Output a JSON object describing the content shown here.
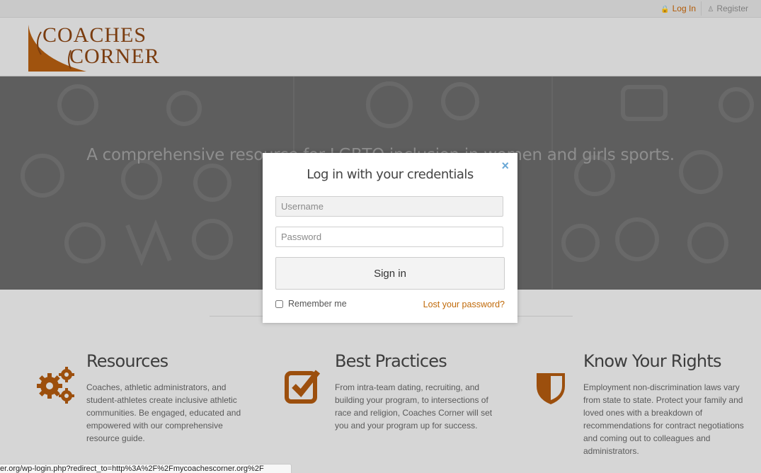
{
  "topbar": {
    "login_label": "Log In",
    "register_label": "Register"
  },
  "logo": {
    "word1": "COACHES",
    "word2": "CORNER"
  },
  "hero": {
    "tagline": "A  comprehensive resource for LGBTQ inclusion in women and girls sports."
  },
  "features": [
    {
      "title": "Resources",
      "text": "Coaches, athletic administrators, and student-athletes create inclusive athletic communities.  Be engaged, educated and empowered with our comprehensive resource guide.",
      "icon": "gears-icon"
    },
    {
      "title": "Best Practices",
      "text": "From intra-team dating, recruiting, and building your program, to intersections of race and religion, Coaches Corner will set you and your program up for success.",
      "icon": "checkbox-icon"
    },
    {
      "title": "Know Your Rights",
      "text": "Employment non-discrimination laws vary from state to state. Protect your family and loved ones with a breakdown of recommendations for contract negotiations and coming out to colleagues and administrators.",
      "icon": "shield-icon"
    }
  ],
  "modal": {
    "title": "Log in with your credentials",
    "close_label": "×",
    "username_placeholder": "Username",
    "password_placeholder": "Password",
    "signin_label": "Sign in",
    "remember_label": "Remember me",
    "lost_password_label": "Lost your password?"
  },
  "status_bar": {
    "url": "er.org/wp-login.php?redirect_to=http%3A%2F%2Fmycoachescorner.org%2F"
  },
  "colors": {
    "brand_orange": "#b25a05",
    "link_blue": "#6aa8d6",
    "overlay_gray": "#5e5e5e"
  }
}
